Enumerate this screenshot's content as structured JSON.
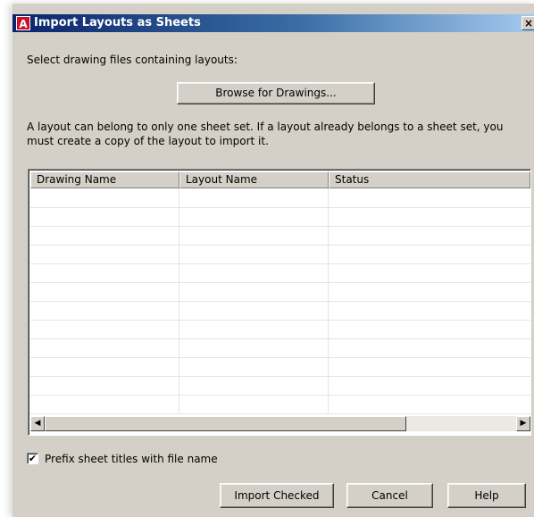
{
  "window": {
    "app_icon": "A",
    "title": "Import Layouts as Sheets",
    "close_glyph": "×"
  },
  "select_label": "Select drawing files containing layouts:",
  "browse_button": "Browse for Drawings...",
  "info_text": "A layout can belong to only one sheet set. If a layout already belongs to a sheet set, you must create a copy of the layout to import it.",
  "table": {
    "columns": [
      "Drawing Name",
      "Layout Name",
      "Status"
    ],
    "rows": []
  },
  "scrollbar": {
    "left_arrow": "◀",
    "right_arrow": "▶"
  },
  "prefix_checkbox": {
    "checked": true,
    "label": "Prefix sheet titles with file name"
  },
  "buttons": {
    "import": "Import Checked",
    "cancel": "Cancel",
    "help": "Help"
  }
}
